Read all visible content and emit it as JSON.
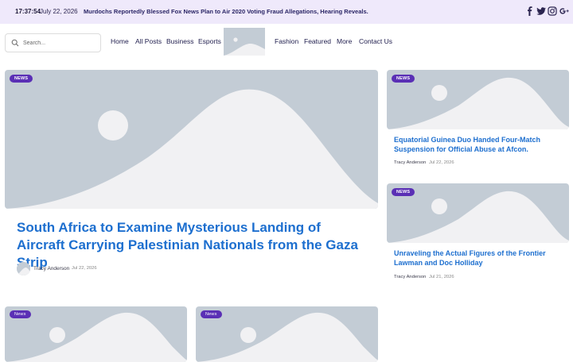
{
  "topbar": {
    "time": "17:37:54",
    "date": "July 22, 2026",
    "ticker": "Murdochs Reportedly Blessed Fox News Plan to Air 2020 Voting Fraud Allegations, Hearing Reveals.",
    "social_icons": [
      "facebook-icon",
      "twitter-icon",
      "instagram-icon",
      "google-plus-icon"
    ]
  },
  "header": {
    "search_placeholder": "Search...",
    "nav_left": [
      "Home",
      "All Posts",
      "Business",
      "Esports"
    ],
    "nav_right": [
      "Fashion",
      "Featured",
      "More",
      "Contact Us"
    ]
  },
  "hero": {
    "badge": "NEWS",
    "title": "South Africa to Examine Mysterious Landing of Aircraft Carrying Palestinian Nationals from the Gaza Strip",
    "author": "Tracy Anderson",
    "date": "Jul 22, 2026"
  },
  "side_posts": [
    {
      "badge": "NEWS",
      "title": "Equatorial Guinea Duo Handed Four-Match Suspension for Official Abuse at Afcon.",
      "author": "Tracy Anderson",
      "date": "Jul 22, 2026"
    },
    {
      "badge": "NEWS",
      "title": "Unraveling the Actual Figures of the Frontier Lawman and Doc Holliday",
      "author": "Tracy Anderson",
      "date": "Jul 21, 2026"
    }
  ],
  "bottom_posts": [
    {
      "badge": "News"
    },
    {
      "badge": "News"
    }
  ],
  "colors": {
    "topbar_bg": "#efe9fb",
    "accent": "#5a2fb5",
    "title_blue": "#1d6fcf",
    "placeholder_bg": "#c3ccd5"
  }
}
